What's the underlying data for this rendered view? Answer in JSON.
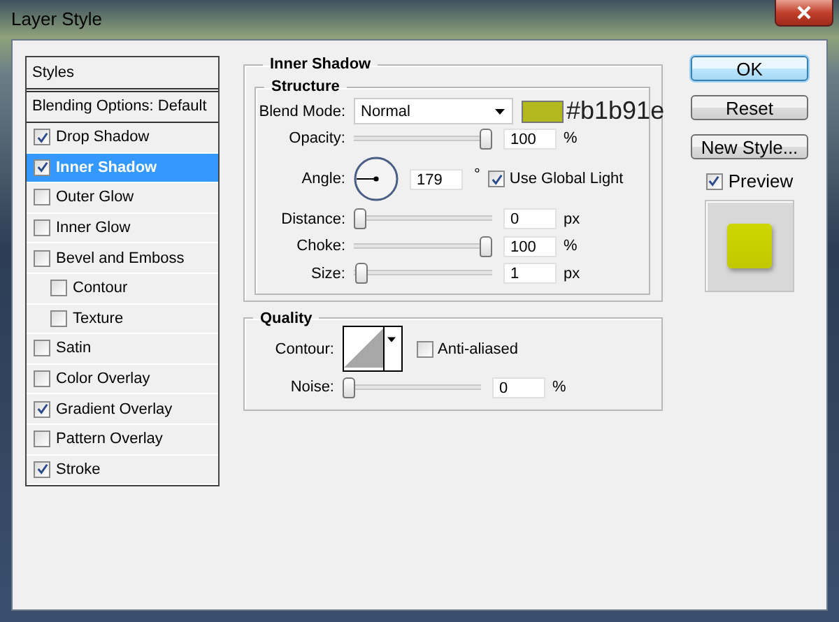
{
  "window": {
    "title": "Layer Style"
  },
  "styles_panel": {
    "header": "Styles",
    "blending_options": {
      "label": "Blending Options: Default",
      "selected": false
    },
    "effects": [
      {
        "label": "Drop Shadow",
        "checked": true,
        "selected": false
      },
      {
        "label": "Inner Shadow",
        "checked": true,
        "selected": true
      },
      {
        "label": "Outer Glow",
        "checked": false,
        "selected": false
      },
      {
        "label": "Inner Glow",
        "checked": false,
        "selected": false
      },
      {
        "label": "Bevel and Emboss",
        "checked": false,
        "selected": false,
        "children": [
          {
            "label": "Contour",
            "checked": false,
            "selected": false
          },
          {
            "label": "Texture",
            "checked": false,
            "selected": false
          }
        ]
      },
      {
        "label": "Satin",
        "checked": false,
        "selected": false
      },
      {
        "label": "Color Overlay",
        "checked": false,
        "selected": false
      },
      {
        "label": "Gradient Overlay",
        "checked": true,
        "selected": false
      },
      {
        "label": "Pattern Overlay",
        "checked": false,
        "selected": false
      },
      {
        "label": "Stroke",
        "checked": true,
        "selected": false
      }
    ]
  },
  "inner_shadow": {
    "title": "Inner Shadow",
    "structure": {
      "title": "Structure",
      "blend_mode": {
        "label": "Blend Mode:",
        "value": "Normal"
      },
      "color_swatch": {
        "color": "#b1b91e"
      },
      "color_annotation": "#b1b91e",
      "rows": [
        {
          "kind": "slider",
          "label": "Opacity:",
          "level": 1,
          "value": "100",
          "unit": "%"
        },
        {
          "kind": "angle",
          "label": "Angle:",
          "value": "179",
          "unit": "°",
          "global_light": {
            "label": "Use Global Light",
            "checked": true
          }
        },
        {
          "kind": "slider",
          "label": "Distance:",
          "level": 0,
          "value": "0",
          "unit": "px"
        },
        {
          "kind": "slider",
          "label": "Choke:",
          "level": 1,
          "value": "100",
          "unit": "%"
        },
        {
          "kind": "slider",
          "label": "Size:",
          "level": 0.01,
          "value": "1",
          "unit": "px"
        }
      ]
    },
    "quality": {
      "title": "Quality",
      "contour": {
        "label": "Contour:"
      },
      "anti_aliased": {
        "label": "Anti-aliased",
        "checked": false
      },
      "noise": {
        "label": "Noise:",
        "level": 0,
        "value": "0",
        "unit": "%"
      }
    }
  },
  "buttons": [
    {
      "label": "OK",
      "default": true
    },
    {
      "label": "Reset",
      "default": false
    },
    {
      "label": "New Style...",
      "default": false
    }
  ],
  "preview": {
    "label": "Preview",
    "checked": true
  }
}
